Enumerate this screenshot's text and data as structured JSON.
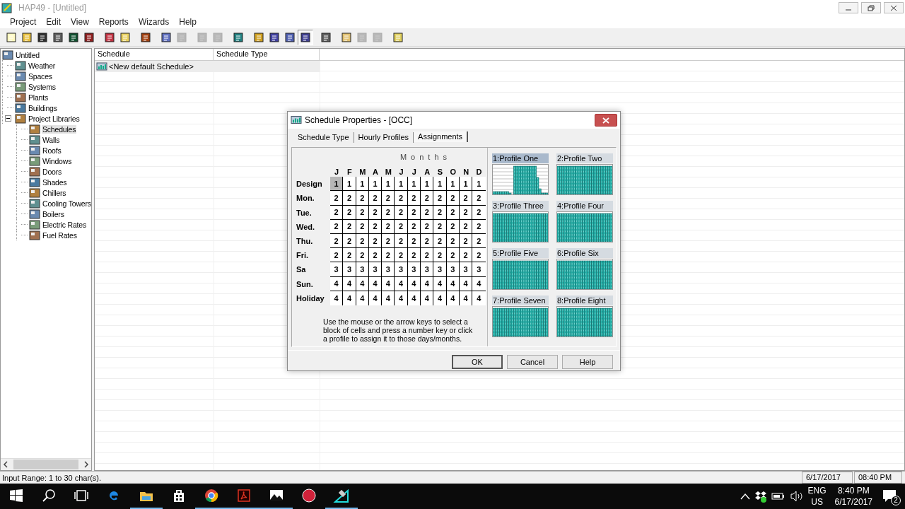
{
  "window": {
    "title": "HAP49 - [Untitled]"
  },
  "menu": [
    "Project",
    "Edit",
    "View",
    "Reports",
    "Wizards",
    "Help"
  ],
  "toolbar": [
    [
      {
        "disabled": false,
        "pressed": false
      },
      {
        "disabled": false,
        "pressed": false
      },
      {
        "disabled": false,
        "pressed": false
      },
      {
        "disabled": false,
        "pressed": false
      },
      {
        "disabled": false,
        "pressed": false
      },
      {
        "disabled": false,
        "pressed": false
      }
    ],
    [
      {
        "disabled": false,
        "pressed": false
      },
      {
        "disabled": false,
        "pressed": false
      }
    ],
    [
      {
        "disabled": false,
        "pressed": false
      }
    ],
    [
      {
        "disabled": false,
        "pressed": false
      },
      {
        "disabled": true,
        "pressed": false
      }
    ],
    [
      {
        "disabled": true,
        "pressed": false
      },
      {
        "disabled": true,
        "pressed": false
      }
    ],
    [
      {
        "disabled": false,
        "pressed": false
      }
    ],
    [
      {
        "disabled": false,
        "pressed": false
      },
      {
        "disabled": false,
        "pressed": false
      },
      {
        "disabled": false,
        "pressed": false
      },
      {
        "disabled": false,
        "pressed": true
      }
    ],
    [
      {
        "disabled": false,
        "pressed": false
      }
    ],
    [
      {
        "disabled": false,
        "pressed": false
      },
      {
        "disabled": true,
        "pressed": false
      },
      {
        "disabled": true,
        "pressed": false
      }
    ],
    [
      {
        "disabled": false,
        "pressed": false
      }
    ]
  ],
  "tree": [
    {
      "label": "Untitled",
      "selected": false,
      "children": [
        {
          "label": "Weather",
          "selected": false
        },
        {
          "label": "Spaces",
          "selected": false
        },
        {
          "label": "Systems",
          "selected": false
        },
        {
          "label": "Plants",
          "selected": false
        },
        {
          "label": "Buildings",
          "selected": false
        },
        {
          "label": "Project Libraries",
          "selected": false,
          "expanded": true,
          "children": [
            {
              "label": "Schedules",
              "selected": true
            },
            {
              "label": "Walls",
              "selected": false
            },
            {
              "label": "Roofs",
              "selected": false
            },
            {
              "label": "Windows",
              "selected": false
            },
            {
              "label": "Doors",
              "selected": false
            },
            {
              "label": "Shades",
              "selected": false
            },
            {
              "label": "Chillers",
              "selected": false
            },
            {
              "label": "Cooling Towers",
              "selected": false
            },
            {
              "label": "Boilers",
              "selected": false
            },
            {
              "label": "Electric Rates",
              "selected": false
            },
            {
              "label": "Fuel Rates",
              "selected": false
            }
          ]
        }
      ]
    }
  ],
  "list": {
    "columns": [
      "Schedule",
      "Schedule Type"
    ],
    "rows": [
      {
        "schedule": "<New default Schedule>",
        "selected": true
      }
    ]
  },
  "status_bar": {
    "message": "Input Range: 1 to 30 char(s).",
    "date": "6/17/2017",
    "time": "08:40 PM"
  },
  "dialog": {
    "title": "Schedule Properties - [OCC]",
    "tabs": [
      {
        "label": "Schedule Type",
        "selected": false
      },
      {
        "label": "Hourly Profiles",
        "selected": false
      },
      {
        "label": "Assignments",
        "selected": true
      }
    ],
    "assignments": {
      "heading": "Months",
      "months": [
        "J",
        "F",
        "M",
        "A",
        "M",
        "J",
        "J",
        "A",
        "S",
        "O",
        "N",
        "D"
      ],
      "rows": [
        {
          "day": "Design",
          "cells": [
            {
              "value": "1",
              "selected": true
            },
            {
              "value": "1",
              "selected": false
            },
            {
              "value": "1",
              "selected": false
            },
            {
              "value": "1",
              "selected": false
            },
            {
              "value": "1",
              "selected": false
            },
            {
              "value": "1",
              "selected": false
            },
            {
              "value": "1",
              "selected": false
            },
            {
              "value": "1",
              "selected": false
            },
            {
              "value": "1",
              "selected": false
            },
            {
              "value": "1",
              "selected": false
            },
            {
              "value": "1",
              "selected": false
            },
            {
              "value": "1",
              "selected": false
            }
          ]
        },
        {
          "day": "Mon.",
          "cells": [
            {
              "value": "2",
              "selected": false
            },
            {
              "value": "2",
              "selected": false
            },
            {
              "value": "2",
              "selected": false
            },
            {
              "value": "2",
              "selected": false
            },
            {
              "value": "2",
              "selected": false
            },
            {
              "value": "2",
              "selected": false
            },
            {
              "value": "2",
              "selected": false
            },
            {
              "value": "2",
              "selected": false
            },
            {
              "value": "2",
              "selected": false
            },
            {
              "value": "2",
              "selected": false
            },
            {
              "value": "2",
              "selected": false
            },
            {
              "value": "2",
              "selected": false
            }
          ]
        },
        {
          "day": "Tue.",
          "cells": [
            {
              "value": "2",
              "selected": false
            },
            {
              "value": "2",
              "selected": false
            },
            {
              "value": "2",
              "selected": false
            },
            {
              "value": "2",
              "selected": false
            },
            {
              "value": "2",
              "selected": false
            },
            {
              "value": "2",
              "selected": false
            },
            {
              "value": "2",
              "selected": false
            },
            {
              "value": "2",
              "selected": false
            },
            {
              "value": "2",
              "selected": false
            },
            {
              "value": "2",
              "selected": false
            },
            {
              "value": "2",
              "selected": false
            },
            {
              "value": "2",
              "selected": false
            }
          ]
        },
        {
          "day": "Wed.",
          "cells": [
            {
              "value": "2",
              "selected": false
            },
            {
              "value": "2",
              "selected": false
            },
            {
              "value": "2",
              "selected": false
            },
            {
              "value": "2",
              "selected": false
            },
            {
              "value": "2",
              "selected": false
            },
            {
              "value": "2",
              "selected": false
            },
            {
              "value": "2",
              "selected": false
            },
            {
              "value": "2",
              "selected": false
            },
            {
              "value": "2",
              "selected": false
            },
            {
              "value": "2",
              "selected": false
            },
            {
              "value": "2",
              "selected": false
            },
            {
              "value": "2",
              "selected": false
            }
          ]
        },
        {
          "day": "Thu.",
          "cells": [
            {
              "value": "2",
              "selected": false
            },
            {
              "value": "2",
              "selected": false
            },
            {
              "value": "2",
              "selected": false
            },
            {
              "value": "2",
              "selected": false
            },
            {
              "value": "2",
              "selected": false
            },
            {
              "value": "2",
              "selected": false
            },
            {
              "value": "2",
              "selected": false
            },
            {
              "value": "2",
              "selected": false
            },
            {
              "value": "2",
              "selected": false
            },
            {
              "value": "2",
              "selected": false
            },
            {
              "value": "2",
              "selected": false
            },
            {
              "value": "2",
              "selected": false
            }
          ]
        },
        {
          "day": "Fri.",
          "cells": [
            {
              "value": "2",
              "selected": false
            },
            {
              "value": "2",
              "selected": false
            },
            {
              "value": "2",
              "selected": false
            },
            {
              "value": "2",
              "selected": false
            },
            {
              "value": "2",
              "selected": false
            },
            {
              "value": "2",
              "selected": false
            },
            {
              "value": "2",
              "selected": false
            },
            {
              "value": "2",
              "selected": false
            },
            {
              "value": "2",
              "selected": false
            },
            {
              "value": "2",
              "selected": false
            },
            {
              "value": "2",
              "selected": false
            },
            {
              "value": "2",
              "selected": false
            }
          ]
        },
        {
          "day": "Sa",
          "cells": [
            {
              "value": "3",
              "selected": false
            },
            {
              "value": "3",
              "selected": false
            },
            {
              "value": "3",
              "selected": false
            },
            {
              "value": "3",
              "selected": false
            },
            {
              "value": "3",
              "selected": false
            },
            {
              "value": "3",
              "selected": false
            },
            {
              "value": "3",
              "selected": false
            },
            {
              "value": "3",
              "selected": false
            },
            {
              "value": "3",
              "selected": false
            },
            {
              "value": "3",
              "selected": false
            },
            {
              "value": "3",
              "selected": false
            },
            {
              "value": "3",
              "selected": false
            }
          ]
        },
        {
          "day": "Sun.",
          "cells": [
            {
              "value": "4",
              "selected": false
            },
            {
              "value": "4",
              "selected": false
            },
            {
              "value": "4",
              "selected": false
            },
            {
              "value": "4",
              "selected": false
            },
            {
              "value": "4",
              "selected": false
            },
            {
              "value": "4",
              "selected": false
            },
            {
              "value": "4",
              "selected": false
            },
            {
              "value": "4",
              "selected": false
            },
            {
              "value": "4",
              "selected": false
            },
            {
              "value": "4",
              "selected": false
            },
            {
              "value": "4",
              "selected": false
            },
            {
              "value": "4",
              "selected": false
            }
          ]
        },
        {
          "day": "Holiday",
          "cells": [
            {
              "value": "4",
              "selected": false
            },
            {
              "value": "4",
              "selected": false
            },
            {
              "value": "4",
              "selected": false
            },
            {
              "value": "4",
              "selected": false
            },
            {
              "value": "4",
              "selected": false
            },
            {
              "value": "4",
              "selected": false
            },
            {
              "value": "4",
              "selected": false
            },
            {
              "value": "4",
              "selected": false
            },
            {
              "value": "4",
              "selected": false
            },
            {
              "value": "4",
              "selected": false
            },
            {
              "value": "4",
              "selected": false
            },
            {
              "value": "4",
              "selected": false
            }
          ]
        }
      ],
      "hint": "Use the mouse or the arrow keys to select a block of cells and press a number key or click a profile to assign it to those days/months."
    },
    "profiles": [
      {
        "label": "1:Profile One",
        "selected": true,
        "kind": "daytime"
      },
      {
        "label": "2:Profile Two",
        "selected": false,
        "kind": "full"
      },
      {
        "label": "3:Profile Three",
        "selected": false,
        "kind": "full"
      },
      {
        "label": "4:Profile Four",
        "selected": false,
        "kind": "full"
      },
      {
        "label": "5:Profile Five",
        "selected": false,
        "kind": "full"
      },
      {
        "label": "6:Profile Six",
        "selected": false,
        "kind": "full"
      },
      {
        "label": "7:Profile Seven",
        "selected": false,
        "kind": "full"
      },
      {
        "label": "8:Profile Eight",
        "selected": false,
        "kind": "full"
      }
    ],
    "buttons": [
      {
        "label": "OK",
        "default": true
      },
      {
        "label": "Cancel",
        "default": false
      },
      {
        "label": "Help",
        "default": false
      }
    ]
  },
  "taskbar": {
    "apps": [
      {
        "running": false
      },
      {
        "running": true
      },
      {
        "running": false
      },
      {
        "running": true
      },
      {
        "running": true
      },
      {
        "running": true
      },
      {
        "running": false
      },
      {
        "running": true
      }
    ],
    "language": "ENG",
    "region": "US",
    "clock_time": "8:40 PM",
    "clock_date": "6/17/2017",
    "notifications": "2"
  }
}
